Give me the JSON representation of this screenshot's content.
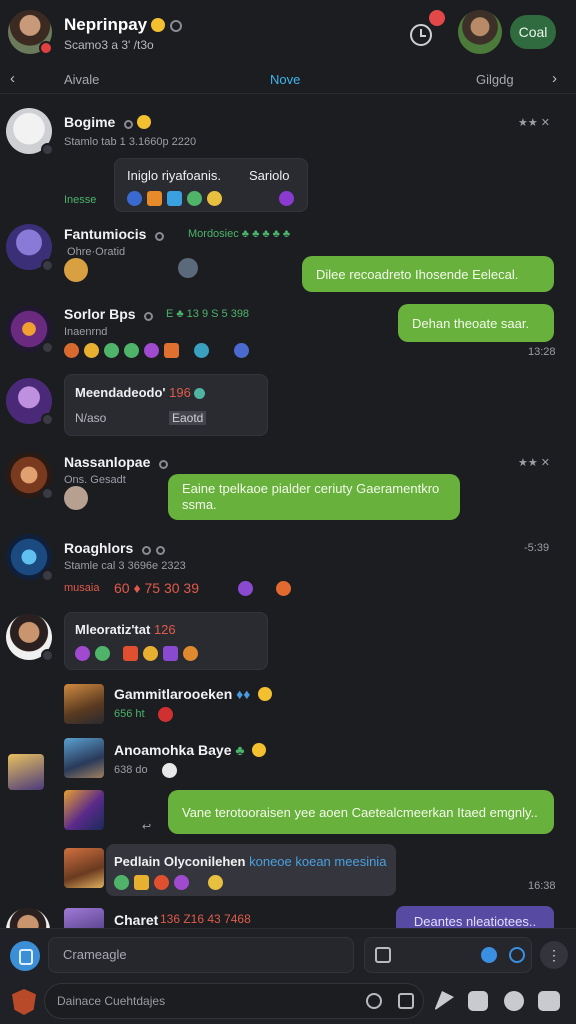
{
  "header": {
    "title": "Neprinpay",
    "subtitle": "Scamo3 a 3' /t3o",
    "send_button": "Coal"
  },
  "tabs": {
    "left": "Aivale",
    "active": "Nove",
    "right": "Gilgdg"
  },
  "messages": [
    {
      "name": "Bogime",
      "subtitle": "Stamlo tab 1 3.1660p 2220",
      "meta": "Inesse",
      "time": "★★ ✕",
      "bubble_title": "Iniglo riyafoanis.",
      "bubble_right": "Sariolo"
    },
    {
      "name": "Fantumiocis",
      "subtitle": " Ohre·Oratid",
      "meta": "Mordosiec ♣ ♣ ♣ ♣ ♣",
      "bubble": "Dilee recoadreto Ihosende Eelecal."
    },
    {
      "name": "Sorlor Bps",
      "subtitle": "Inaenrnd",
      "meta": "E ♣ 13 9 S 5 398",
      "time": "13:28",
      "bubble": "Dehan theoate saar."
    },
    {
      "name": "Meendadeodo'",
      "meta": "196",
      "sub": "N/aso",
      "tag": "Eaotd"
    },
    {
      "name": "Nassanlopae",
      "subtitle": "Ons. Gesadt",
      "time": "★★ ✕",
      "bubble": "Eaine tpelkaoe pialder ceriuty Gaeramentkro ssma."
    },
    {
      "name": "Roaghlors",
      "subtitle": "Stamle cal 3 3696e 2323",
      "meta": "musaia",
      "meta2": "60 ♦ 75 30 39",
      "time": "-5:39"
    },
    {
      "name": "Mleoratiz'tat",
      "meta": "126"
    },
    {
      "name": "Gammitlarooeken",
      "sub": "656 ht"
    },
    {
      "name": "Anoamohka Baye",
      "sub": "638 do"
    },
    {
      "name": "",
      "bubble": "Vane terotooraisen yee aoen Caetealcmeerkan Itaed emgnly.."
    },
    {
      "name": "Pedlain Olyconilehen",
      "name_tail": "koneoe koean meesinia",
      "time": "16:38"
    },
    {
      "name": "Charet",
      "meta": "136 Z16 43 7468",
      "bubble": "Deantes nleatiotees.."
    }
  ],
  "composer": {
    "placeholder": "Crameagle",
    "secondary_placeholder": "Dainace Cuehtdajes"
  }
}
